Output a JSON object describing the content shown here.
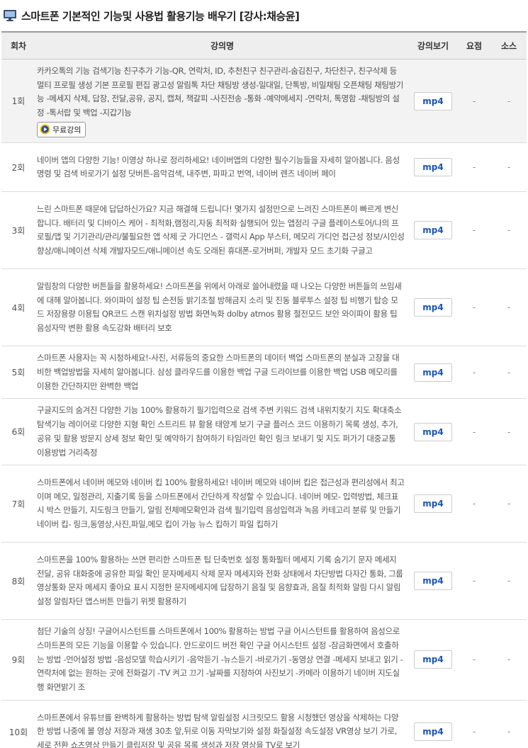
{
  "page": {
    "title": "스마트폰 기본적인 기능및 사용법 활용기능 배우기 [강사:채승윤]"
  },
  "table": {
    "headers": {
      "no": "회차",
      "title": "강의명",
      "view": "강의보기",
      "summary": "요점",
      "source": "소스"
    },
    "free_badge_label": "무료강의",
    "rows": [
      {
        "no": "1회",
        "desc": "카카오톡의 기능 검색기능 친구추가 기능-QR, 연락처, ID, 추천친구 친구관리-숨김친구, 차단친구, 친구삭제 등 멀티 프로필 생성 기본 프로필 편집 광고성 알림톡 차단 채팅방 생성-일대일, 단톡방, 비밀채팅 오픈채팅 채팅방기능 -메세지 삭제, 답장, 전달,공유, 공지, 캡쳐, 책갈피 -사진전송 -통화 -예약메세지 -연락처, 톡명함 -채팅방의 설정 -톡서랍 및 백업 -지갑기능",
        "view": "mp4",
        "summary": "-",
        "source": "-"
      },
      {
        "no": "2회",
        "desc": "네이버 앱의 다양한 기능! 이영상 하나로 정리하세요! 네이버앱의 다양한 필수기능들을 자세히 알아봅니다. 음성명령 및 검색 바로가기 설정 닷버튼-음악검색, 내주변, 파파고 번역, 네이버 렌즈 네이버 페이",
        "view": "mp4",
        "summary": "-",
        "source": "-"
      },
      {
        "no": "3회",
        "desc": "느린 스마트폰 때문에 답답하신가요? 지금 해결해 드립니다! 몇가지 설정만으로 느려진 스마트폰이 빠르게 변신 합니다. 배터리 및 디바이스 케어 - 최적화,램정리,자동 최적화 실행되어 있는 앱정리 구글 플레이스토어/나의 프로필/앱 및 기기관리/관리/불필요한 앱 삭제 굿 가디언스 - 갤럭시 App 부스터, 메모리 가디언 접근성 정보/시인성 향상/애니메이션 삭제 개발자모드/애니메이션 속도 오래된 휴대폰-로거버퍼, 개발자 모드 초기화 구글고",
        "view": "mp4",
        "summary": "-",
        "source": "-"
      },
      {
        "no": "4회",
        "desc": "알림창의 다양한 버튼들을 활용하세요! 스마트폰을 위에서 아래로 쓸어내렸을 때 나오는 다양한 버튼들의 쓰임새에 대해 알아봅니다. 와이파이 설정 팁 손전등 밝기조절 방해금지 소리 및 진동 블루투스 설정 팁 비행기 탑승 모드 저장용량 이용팁 QR코드 스캔 위치설정 방법 화면녹화 dolby atmos 활용 절전모드 보안 와이파이 활용 팁 음성자막 변환 활용 속도강화 배터리 보호",
        "view": "mp4",
        "summary": "-",
        "source": "-"
      },
      {
        "no": "5회",
        "desc": "스마트폰 사용자는 꼭 시청하세요!-사진, 서류등의 중요한 스마트폰의 데이터 백업 스마트폰의 분실과 고장을 대비한 백업방법을 자세히 알아봅니다. 삼성 클라우드를 이용한 백업 구글 드라이브를 이용한 백업 USB 메모리를 이용한 간단하지만 완벽한 백업",
        "view": "mp4",
        "summary": "-",
        "source": "-"
      },
      {
        "no": "6회",
        "desc": "구글지도의 숨겨진 다양한 기능 100% 활용하기 필기입력으로 검색 주변 키워드 검색 내위치찾기 지도 확대축소 탐색기능 레이어로 다양한 지형 확인 스트리트 뷰 활용 태양계 보기 구글 플러스 코드 이용하기 목록 생성, 추가,공유 및 활용 방문지 상세 정보 확인 및 예약하기 참여하기 타임라인 확인 링크 보내기 및 지도 퍼가기 대중교통 이용방법 거리측정",
        "view": "mp4",
        "summary": "-",
        "source": "-"
      },
      {
        "no": "7회",
        "desc": "스마트폰에서 네이버 메모와 네이버 킵 100% 활용하세요! 네이버 메모와 네이버 킵은 접근성과 편리성에서 최고이며 메모, 일정관리, 지출기록 등을 스마트폰에서 간단하게 작성할 수 있습니다. 네이버 메모- 입력방법, 체크표시 박스 만들기, 지도링크 만들기, 알림 전체메모확인과 검색 필기입력 음성입력과 녹음 카테고리 분류 및 만들기 네이버 킵- 링크,동영상,사진,파일,메모 킵이 가능 뉴스 킵하기 파일 킵하기",
        "view": "mp4",
        "summary": "-",
        "source": "-"
      },
      {
        "no": "8회",
        "desc": "스마트폰을 100% 활용하는 쓰면 편리한 스마트폰 팁 단축번호 설정 통화필터 메세지 기록 숨기기 문자 메세지 전달, 공유 대화중에 공유한 파일 확인 문자메세지 삭제 문자 메세지와 전화 상태에서 차단방법 다자간 통화, 그룹 영상통화 문자 메세지 좋아요 표시 지정한 문자메세지에 답장하기 음질 및 음향효과, 음질 최적화 알림 다시 알림 설정 알림차단 앱스버튼 만들기 위젯 활용하기",
        "view": "mp4",
        "summary": "-",
        "source": "-"
      },
      {
        "no": "9회",
        "desc": "첨단 기술의 상징! 구글어시스턴트를 스마트폰에서 100% 활용하는 방법 구글 어시스턴트를 활용하여 음성으로 스마트폰의 모든 기능을 이용할 수 있습니다. 안드로이드 버전 확인 구글 어시스턴트 설정 -잠금화면에서 호출하는 방법 -언어설정 방법 -음성모델 학습시키기 -음악듣기 -뉴스듣기 -바로가기 -동영상 연결 -메세지 보내고 읽기 -연락처에 없는 원하는 곳에 전화걸기 -TV 켜고 끄기 -날짜를 지정하여 사진보기 -카메라 이용하기 네이버 지도실행 화면밝기 조",
        "view": "mp4",
        "summary": "-",
        "source": "-"
      },
      {
        "no": "10회",
        "desc": "스마트폰에서 유튜브를 완벽하게 활용하는 방법 탐색 알림설정 시크릿모드 활용 시청했던 영상을 삭제하는 다양한 방법 나중에 볼 영상 저장과 재생 30초 앞,뒤로 이동 자막보기와 설정 화질설정 속도설정 VR영상 보기 가로, 세로 전환 쇼츠영상 만들기 클립저장 및 공유 목록 생성과 저장 영상을 TV로 보기",
        "view": "mp4",
        "summary": "-",
        "source": "-"
      }
    ]
  },
  "icons": {
    "title": "monitor-icon",
    "free_badge": "play-icon"
  },
  "colors": {
    "mp4_link": "#1a55b5",
    "header_bg": "#eeeeee",
    "first_row_bg": "#f3f3f3"
  }
}
